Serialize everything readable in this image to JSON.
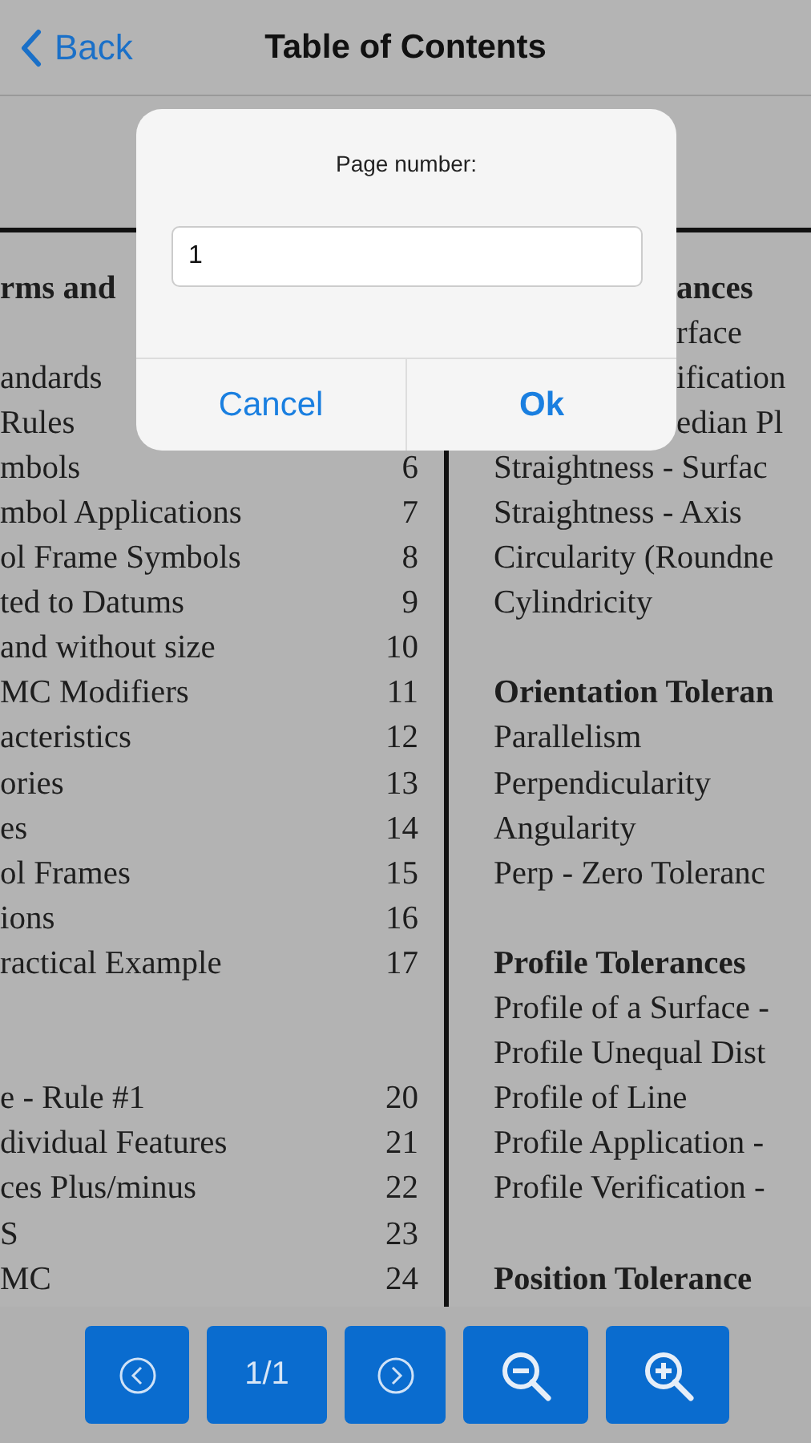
{
  "nav": {
    "back": "Back",
    "title": "Table of Contents"
  },
  "document": {
    "left": [
      {
        "kind": "heading",
        "text": "rms and"
      },
      {
        "kind": "blank"
      },
      {
        "kind": "entry",
        "text": "andards"
      },
      {
        "kind": "entry",
        "text": "Rules"
      },
      {
        "kind": "entry",
        "text": "mbols",
        "page": "6"
      },
      {
        "kind": "entry",
        "text": "mbol Applications",
        "page": "7"
      },
      {
        "kind": "entry",
        "text": "ol Frame Symbols",
        "page": "8"
      },
      {
        "kind": "entry",
        "text": "ted to Datums",
        "page": "9"
      },
      {
        "kind": "entry",
        "text": "and without size",
        "page": "10"
      },
      {
        "kind": "entry",
        "text": "MC Modifiers",
        "page": "11"
      },
      {
        "kind": "entry",
        "text": "acteristics",
        "page": "12"
      },
      {
        "kind": "entry",
        "text": "ories",
        "page": "13"
      },
      {
        "kind": "entry",
        "text": "es",
        "page": "14"
      },
      {
        "kind": "entry",
        "text": "ol Frames",
        "page": "15"
      },
      {
        "kind": "entry",
        "text": "ions",
        "page": "16"
      },
      {
        "kind": "entry",
        "text": "ractical Example",
        "page": "17"
      },
      {
        "kind": "blank"
      },
      {
        "kind": "blank"
      },
      {
        "kind": "entry",
        "text": "e - Rule #1",
        "page": "20"
      },
      {
        "kind": "entry",
        "text": "dividual Features",
        "page": "21"
      },
      {
        "kind": "entry",
        "text": "ces Plus/minus",
        "page": "22"
      },
      {
        "kind": "entry",
        "text": "S",
        "page": "23"
      },
      {
        "kind": "entry",
        "text": "MC",
        "page": "24"
      }
    ],
    "right": [
      {
        "kind": "heading-tail",
        "text": "ances"
      },
      {
        "kind": "entry-tail",
        "text": "rface"
      },
      {
        "kind": "entry-tail",
        "text": "ification"
      },
      {
        "kind": "entry-tail",
        "text": "edian Pl"
      },
      {
        "kind": "entry",
        "text": "Straightness - Surfac"
      },
      {
        "kind": "entry",
        "text": "Straightness - Axis"
      },
      {
        "kind": "entry",
        "text": "Circularity (Roundne"
      },
      {
        "kind": "entry",
        "text": "Cylindricity"
      },
      {
        "kind": "blank"
      },
      {
        "kind": "heading",
        "text": "Orientation Toleran"
      },
      {
        "kind": "entry",
        "text": "Parallelism"
      },
      {
        "kind": "entry",
        "text": "Perpendicularity"
      },
      {
        "kind": "entry",
        "text": "Angularity"
      },
      {
        "kind": "entry",
        "text": "Perp - Zero Toleranc"
      },
      {
        "kind": "blank"
      },
      {
        "kind": "heading",
        "text": "Profile Tolerances"
      },
      {
        "kind": "entry",
        "text": "Profile of a Surface -"
      },
      {
        "kind": "entry",
        "text": "Profile Unequal Dist"
      },
      {
        "kind": "entry",
        "text": "Profile of Line"
      },
      {
        "kind": "entry",
        "text": "Profile Application -"
      },
      {
        "kind": "entry",
        "text": "Profile Verification -"
      },
      {
        "kind": "blank"
      },
      {
        "kind": "heading",
        "text": "Position Tolerance"
      }
    ]
  },
  "dialog": {
    "title": "Page number:",
    "field": {
      "value": "1"
    },
    "buttons": [
      {
        "kind": "cancel",
        "label": "Cancel"
      },
      {
        "kind": "confirm",
        "label": "Ok"
      }
    ]
  },
  "toolbar": [
    {
      "kind": "prev"
    },
    {
      "kind": "page",
      "label": "1/1"
    },
    {
      "kind": "next"
    },
    {
      "kind": "zoom-out"
    },
    {
      "kind": "zoom-in"
    }
  ]
}
